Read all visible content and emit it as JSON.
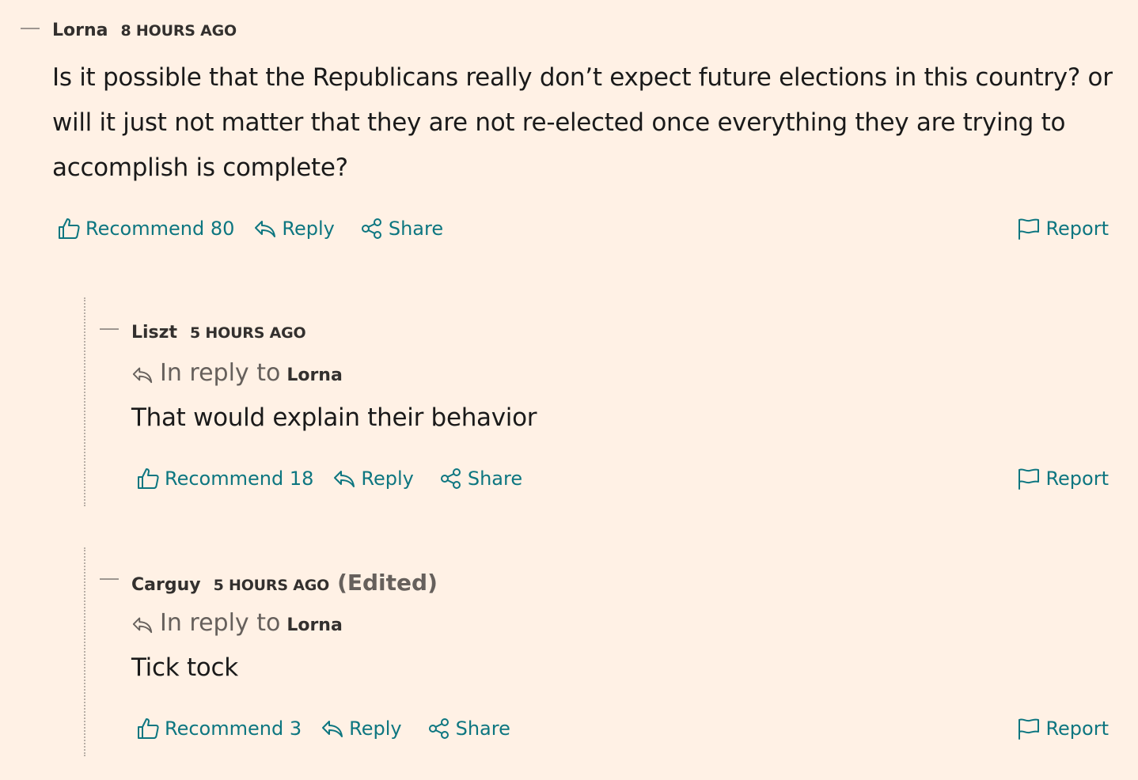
{
  "comments": [
    {
      "author": "Lorna",
      "timestamp": "8 HOURS AGO",
      "body_lines": [
        "Is it possible that the Republicans really don’t expect future elections in this country? or",
        "will it just not matter that they are not re-elected once everything they are trying to",
        "accomplish is complete?"
      ],
      "recommend_label": "Recommend 80",
      "reply_label": "Reply",
      "share_label": "Share",
      "report_label": "Report"
    },
    {
      "author": "Liszt",
      "timestamp": "5 HOURS AGO",
      "in_reply_label": "In reply to",
      "in_reply_target": "Lorna",
      "body_lines": [
        "That would explain their behavior"
      ],
      "recommend_label": "Recommend 18",
      "reply_label": "Reply",
      "share_label": "Share",
      "report_label": "Report"
    },
    {
      "author": "Carguy",
      "timestamp": "5 HOURS AGO",
      "edited_label": "(Edited)",
      "in_reply_label": "In reply to",
      "in_reply_target": "Lorna",
      "body_lines": [
        "Tick tock"
      ],
      "recommend_label": "Recommend 3",
      "reply_label": "Reply",
      "share_label": "Share",
      "report_label": "Report"
    }
  ],
  "colors": {
    "background": "#fff1e5",
    "link": "#0d7680",
    "text": "#1a1a1a",
    "muted": "#66605c"
  },
  "icons": {
    "recommend": "thumbs-up-icon",
    "reply": "reply-arrow-icon",
    "share": "share-icon",
    "report": "flag-icon",
    "in_reply": "reply-arrow-icon"
  }
}
